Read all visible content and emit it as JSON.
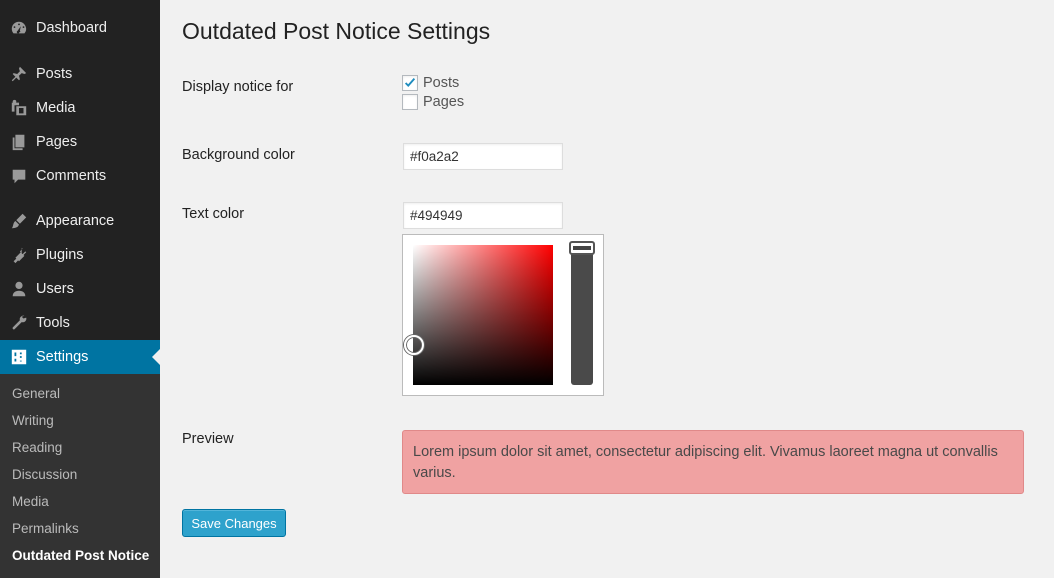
{
  "sidebar": {
    "items": [
      {
        "label": "Dashboard",
        "icon": "dashboard-icon"
      },
      {
        "label": "Posts",
        "icon": "pin-icon"
      },
      {
        "label": "Media",
        "icon": "media-icon"
      },
      {
        "label": "Pages",
        "icon": "pages-icon"
      },
      {
        "label": "Comments",
        "icon": "comment-icon"
      },
      {
        "label": "Appearance",
        "icon": "brush-icon"
      },
      {
        "label": "Plugins",
        "icon": "plug-icon"
      },
      {
        "label": "Users",
        "icon": "user-icon"
      },
      {
        "label": "Tools",
        "icon": "wrench-icon"
      },
      {
        "label": "Settings",
        "icon": "settings-icon",
        "active": true
      }
    ],
    "submenu": [
      {
        "label": "General"
      },
      {
        "label": "Writing"
      },
      {
        "label": "Reading"
      },
      {
        "label": "Discussion"
      },
      {
        "label": "Media"
      },
      {
        "label": "Permalinks"
      },
      {
        "label": "Outdated Post Notice",
        "current": true
      }
    ]
  },
  "page": {
    "title": "Outdated Post Notice Settings"
  },
  "form": {
    "display_notice_label": "Display notice for",
    "checkboxes": [
      {
        "label": "Posts",
        "checked": true
      },
      {
        "label": "Pages",
        "checked": false
      }
    ],
    "background_color_label": "Background color",
    "background_color_value": "#f0a2a2",
    "text_color_label": "Text color",
    "text_color_value": "#494949",
    "preview_label": "Preview",
    "preview_text": "Lorem ipsum dolor sit amet, consectetur adipiscing elit. Vivamus laoreet magna ut convallis varius.",
    "save_label": "Save Changes"
  },
  "colors": {
    "sidebar_bg": "#222222",
    "active_bg": "#0074a2",
    "preview_bg": "#f0a2a2",
    "preview_text": "#494949",
    "button_bg": "#2ea2cc"
  }
}
